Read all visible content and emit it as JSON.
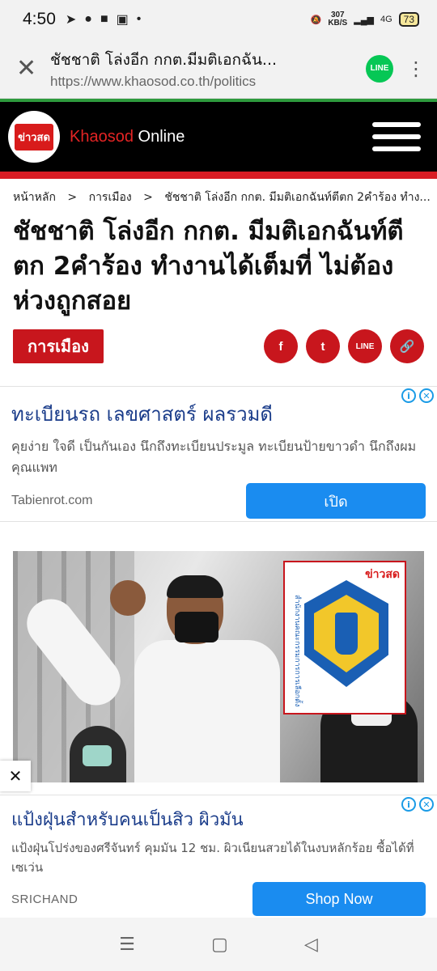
{
  "status": {
    "time": "4:50",
    "speed_top": "307",
    "speed_bottom": "KB/S",
    "network": "4G",
    "battery": "73"
  },
  "browser": {
    "page_title": "ชัชชาติ โล่งอีก กกต.มีมติเอกฉัน...",
    "url": "https://www.khaosod.co.th/politics",
    "line_label": "LINE"
  },
  "site": {
    "logo_text": "ข่าวสด",
    "name_red": "Khaosod",
    "name_white": "Online"
  },
  "breadcrumb": {
    "home": "หน้าหลัก",
    "section": "การเมือง",
    "current": "ชัชชาติ โล่งอีก กกต. มีมติเอกฉันท์ตีตก 2คำร้อง ทำง...",
    "separator": ">"
  },
  "article": {
    "headline": "ชัชชาติ โล่งอีก กกต. มีมติเอกฉันท์ตีตก 2คำร้อง ทำงานได้เต็มที่ ไม่ต้องห่วงถูกสอย",
    "category": "การเมือง",
    "share_facebook": "f",
    "share_twitter": "t",
    "share_line": "LINE",
    "share_link": "🔗"
  },
  "ad1": {
    "title": "ทะเบียนรถ เลขศาสตร์ ผลรวมดี",
    "description": "คุยง่าย ใจดี เป็นกันเอง นึกถึงทะเบียนประมูล ทะเบียนป้ายขาวดำ นึกถึงผม คุณแพท",
    "domain": "Tabienrot.com",
    "cta": "เปิด"
  },
  "photo": {
    "watermark": "ข่าวสด",
    "emblem_text": "สำนักงานคณะกรรมการการเลือกตั้ง"
  },
  "ad2": {
    "title": "แป้งฝุ่นสำหรับคนเป็นสิว ผิวมัน",
    "description": "แป้งฝุ่นโปร่งของศรีจันทร์ คุมมัน 12 ชม. ผิวเนียนสวยได้ในงบหลักร้อย ซื้อได้ที่เซเว่น",
    "domain": "SRICHAND",
    "cta": "Shop Now"
  },
  "icons": {
    "close": "✕",
    "dots": "⋮",
    "ad_info": "i",
    "ad_close": "✕",
    "float_close": "✕",
    "nav_menu": "☰",
    "nav_home": "▢",
    "nav_back": "◁"
  }
}
